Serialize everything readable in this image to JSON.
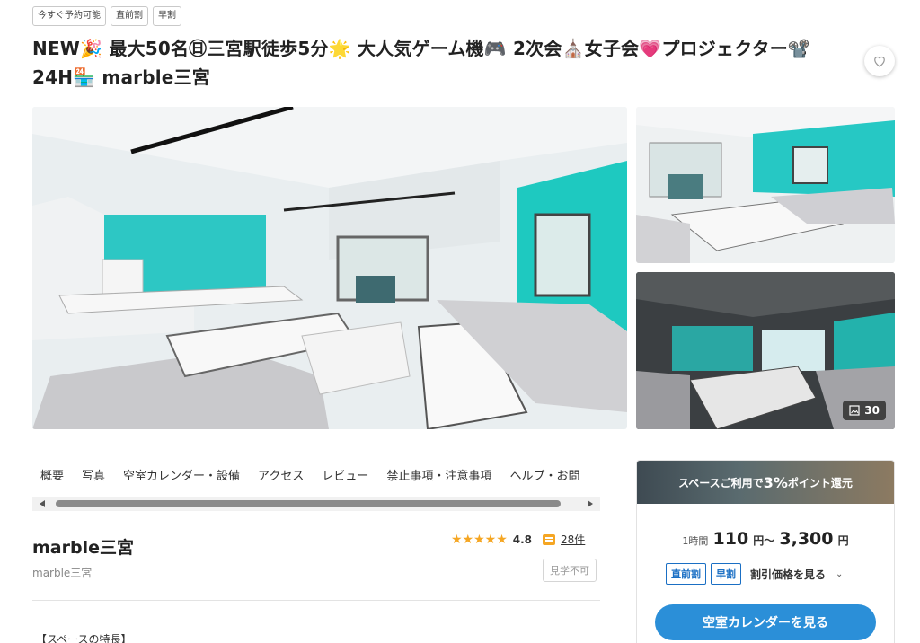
{
  "tags": [
    "今すぐ予約可能",
    "直前割",
    "早割"
  ],
  "title": "NEW🎉 最大50名㊐三宮駅徒歩5分🌟 大人気ゲーム機🎮 2次会⛪女子会💗プロジェクター📽️ 24H🏪 marble三宮",
  "gallery": {
    "photo_count": "30"
  },
  "tabs": [
    "概要",
    "写真",
    "空室カレンダー・設備",
    "アクセス",
    "レビュー",
    "禁止事項・注意事項",
    "ヘルプ・お問"
  ],
  "space": {
    "name": "marble三宮",
    "subtitle": "marble三宮",
    "rating": "4.8",
    "stars": "★★★★★",
    "review_count": "28件",
    "visit_label": "見学不可",
    "feature_heading": "【スペースの特長】"
  },
  "booking": {
    "banner_prefix": "スペースご利用で",
    "banner_percent": "3%",
    "banner_suffix": "ポイント還元",
    "price_unit": "1時間",
    "price_from": "110",
    "price_sep": "円～",
    "price_to": "3,300",
    "price_yen": "円",
    "discount_badges": [
      "直前割",
      "早割"
    ],
    "discount_link": "割引価格を見る",
    "cta": "空室カレンダーを見る"
  },
  "colors": {
    "accent": "#2b8fd8",
    "badge": "#1a6fc4",
    "star": "#f5a623",
    "teal_wall": "#1ec9c0"
  }
}
